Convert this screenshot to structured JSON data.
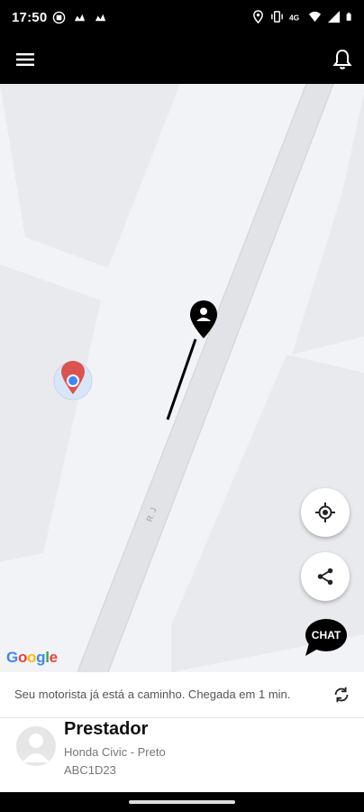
{
  "status_bar": {
    "time": "17:50",
    "left_icons": [
      "whatsapp-icon",
      "notification-icon",
      "notification-icon"
    ],
    "right_icons": [
      "location-icon",
      "vibrate-icon",
      "volte-icon",
      "wifi-icon",
      "signal-icon",
      "battery-icon"
    ]
  },
  "header": {
    "menu_icon": "hamburger-menu-icon",
    "notification_icon": "bell-icon"
  },
  "map": {
    "attribution": "Google",
    "street_label": "R. J",
    "buttons": {
      "locate": "my-location-icon",
      "share": "share-icon",
      "chat_label": "CHAT"
    }
  },
  "trip": {
    "status": "Seu motorista já está a caminho. Chegada em 1 min.",
    "driver_name": "Prestador",
    "vehicle": "Honda Civic - Preto",
    "plate": "ABC1D23"
  },
  "colors": {
    "header_bg": "#000000",
    "map_bg": "#f2f3f6",
    "pin_red": "#d9534f",
    "user_dot": "#4285f4"
  }
}
